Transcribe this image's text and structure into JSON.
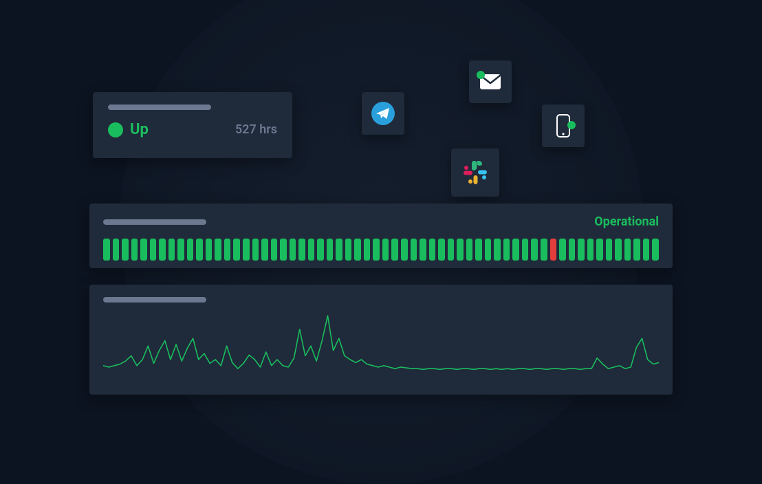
{
  "status": {
    "label": "Up",
    "hours": "527 hrs",
    "dot_color": "#1abd5e"
  },
  "operational": {
    "label": "Operational",
    "bar_count": 60,
    "down_indices": [
      48
    ],
    "up_color": "#1abd5e",
    "down_color": "#e43d3d"
  },
  "integrations": {
    "telegram": "telegram-icon",
    "mail": "mail-icon",
    "phone": "phone-icon",
    "slack": "slack-icon"
  },
  "colors": {
    "bg": "#0c1421",
    "card": "#1f2a3a",
    "muted": "#6b7890",
    "accent": "#1abd5e",
    "telegram": "#29a0dc",
    "slack_blue": "#36c5f0",
    "slack_green": "#2eb67d",
    "slack_red": "#e01e5a",
    "slack_yellow": "#ecb22e"
  },
  "chart_data": {
    "type": "line",
    "title": "",
    "xlabel": "",
    "ylabel": "",
    "ylim": [
      0,
      100
    ],
    "x": [
      0,
      1,
      2,
      3,
      4,
      5,
      6,
      7,
      8,
      9,
      10,
      11,
      12,
      13,
      14,
      15,
      16,
      17,
      18,
      19,
      20,
      21,
      22,
      23,
      24,
      25,
      26,
      27,
      28,
      29,
      30,
      31,
      32,
      33,
      34,
      35,
      36,
      37,
      38,
      39,
      40,
      41,
      42,
      43,
      44,
      45,
      46,
      47,
      48,
      49,
      50,
      51,
      52,
      53,
      54,
      55,
      56,
      57,
      58,
      59,
      60,
      61,
      62,
      63,
      64,
      65,
      66,
      67,
      68,
      69,
      70,
      71,
      72,
      73,
      74,
      75,
      76,
      77,
      78,
      79,
      80,
      81,
      82,
      83,
      84,
      85,
      86,
      87,
      88,
      89,
      90,
      91,
      92,
      93,
      94,
      95,
      96,
      97,
      98,
      99
    ],
    "values": [
      22,
      20,
      22,
      24,
      28,
      35,
      22,
      30,
      48,
      25,
      42,
      55,
      30,
      50,
      28,
      45,
      58,
      30,
      38,
      25,
      30,
      22,
      48,
      26,
      18,
      25,
      36,
      30,
      20,
      40,
      22,
      30,
      22,
      20,
      32,
      70,
      35,
      48,
      28,
      55,
      88,
      42,
      58,
      35,
      30,
      26,
      30,
      24,
      22,
      20,
      22,
      20,
      18,
      20,
      19,
      18,
      18,
      17,
      18,
      18,
      17,
      18,
      18,
      17,
      18,
      18,
      17,
      18,
      18,
      17,
      18,
      17,
      18,
      17,
      18,
      18,
      17,
      18,
      18,
      17,
      18,
      18,
      17,
      18,
      18,
      17,
      18,
      18,
      32,
      24,
      18,
      20,
      22,
      18,
      20,
      46,
      58,
      30,
      24,
      26
    ]
  }
}
